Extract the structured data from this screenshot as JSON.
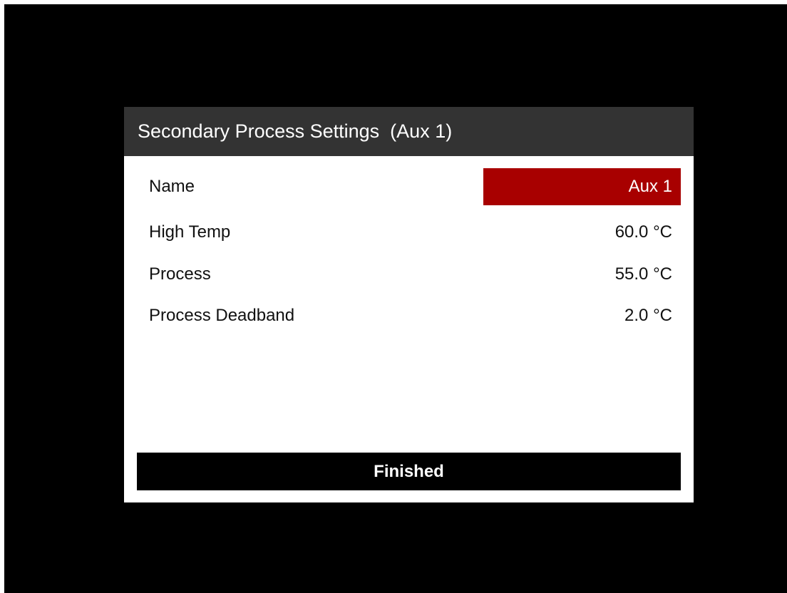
{
  "dialog": {
    "title": "Secondary Process Settings  (Aux 1)",
    "rows": [
      {
        "label": "Name",
        "value": "Aux 1",
        "selected": true
      },
      {
        "label": "High Temp",
        "value": "60.0 °C"
      },
      {
        "label": "Process",
        "value": "55.0 °C"
      },
      {
        "label": "Process Deadband",
        "value": "2.0 °C"
      }
    ],
    "finished_label": "Finished"
  },
  "colors": {
    "background": "#000000",
    "header": "#333333",
    "selected": "#a80000",
    "button": "#000000"
  }
}
